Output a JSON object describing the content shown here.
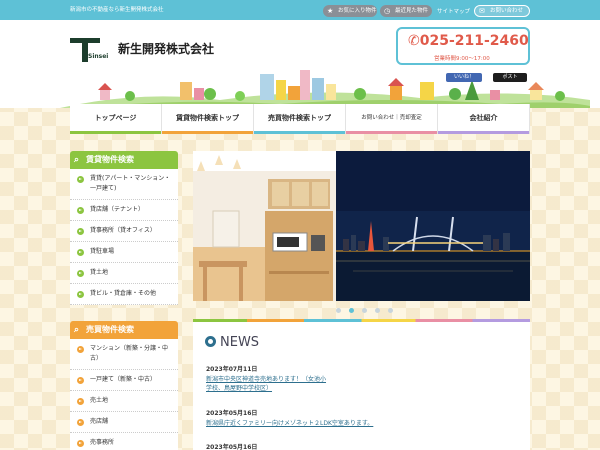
{
  "topbar": {
    "tagline": "新潟市の不動産なら新生開発株式会社",
    "favorites": "お気に入り物件",
    "recent": "最近見た物件",
    "sitemap": "サイトマップ",
    "contact": "お問い合わせ"
  },
  "header": {
    "logo_text": "Sinsei",
    "company_name": "新生開発株式会社",
    "phone": "025-211-2460",
    "hours": "営業時間9:00～17:00",
    "facebook": "いいね！",
    "twitter": "ポスト"
  },
  "nav": [
    {
      "label": "トップページ",
      "color": "#8cc540"
    },
    {
      "label": "賃貸物件検索トップ",
      "color": "#f2a33a"
    },
    {
      "label": "売買物件検索トップ",
      "color": "#5ec1d6"
    },
    {
      "label": "お問い合わせ｜売却査定",
      "color": "#e98fa4"
    },
    {
      "label": "会社紹介",
      "color": "#b49be0"
    }
  ],
  "sidebar": {
    "rent_title": "賃貸物件検索",
    "rent_items": [
      "賃貸(アパート・マンション・一戸建て)",
      "貸店舗（テナント）",
      "貸事務所（貸オフィス）",
      "貸駐車場",
      "貸土地",
      "貸ビル・貸倉庫・その他"
    ],
    "sale_title": "売買物件検索",
    "sale_items": [
      "マンション（新築・分譲・中古）",
      "一戸建て（新築・中古）",
      "売土地",
      "売店舗",
      "売事務所"
    ]
  },
  "news": {
    "title": "NEWS",
    "items": [
      {
        "date": "2023年07月11日",
        "text": "新潟市中央区神道寺売地あります！（女池小学校、鳥屋野中学校区）"
      },
      {
        "date": "2023年05月16日",
        "text": "新潟県庁近くファミリー向けメゾネット２LDK空室あります。"
      },
      {
        "date": "2023年05月16日",
        "text": ""
      }
    ]
  },
  "colors": {
    "primary": "#5ec1d6",
    "green": "#8cc540",
    "orange": "#f2a33a",
    "phone_red": "#e05a4a"
  }
}
